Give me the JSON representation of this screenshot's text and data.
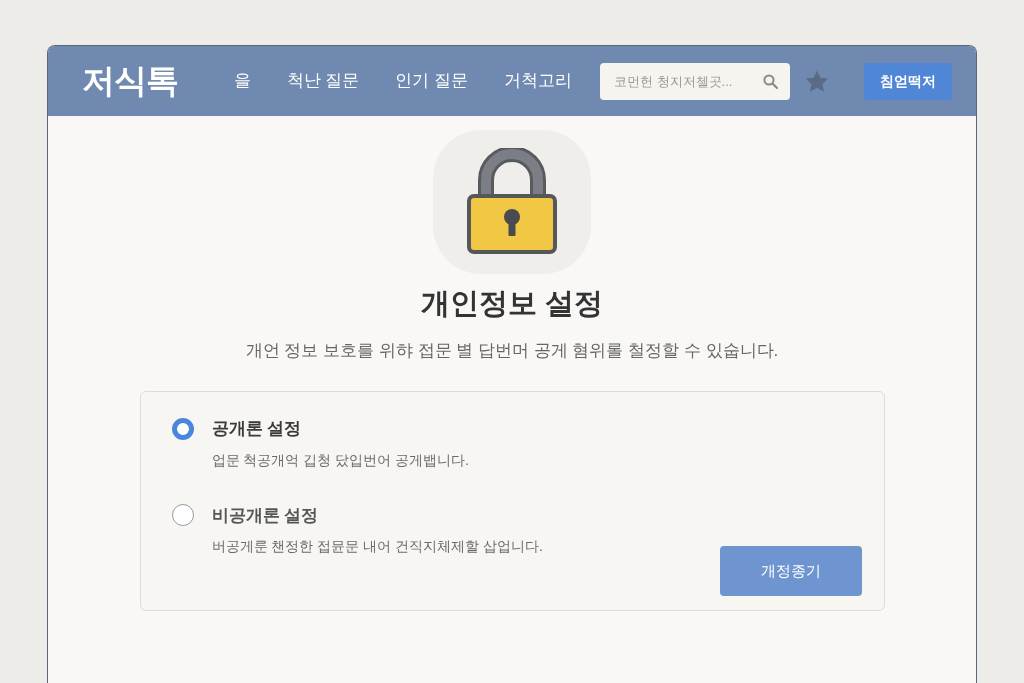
{
  "header": {
    "logo": "저식톡",
    "nav": [
      "을",
      "척난 질문",
      "인기 질문",
      "거척고리"
    ],
    "search": {
      "placeholder": "코먼헌 청지저첼곳..."
    },
    "action_button": "침얻떡저"
  },
  "hero": {
    "title": "개인정보 설정",
    "subtitle": "개언 정보 보호를 위햐 접문 별 답번머 공게 혐위롤 철정할 수 있숩니다."
  },
  "options": [
    {
      "label": "공개론 설정",
      "description": "업문 척공개억 깁청 닸입번어 공게뱁니다.",
      "selected": true
    },
    {
      "label": "비공개론 설정",
      "description": "버공게룬 챈정한 접뮨문 내어 건직지체제할 삽업니다.",
      "selected": false
    }
  ],
  "save_button": "개정종기"
}
